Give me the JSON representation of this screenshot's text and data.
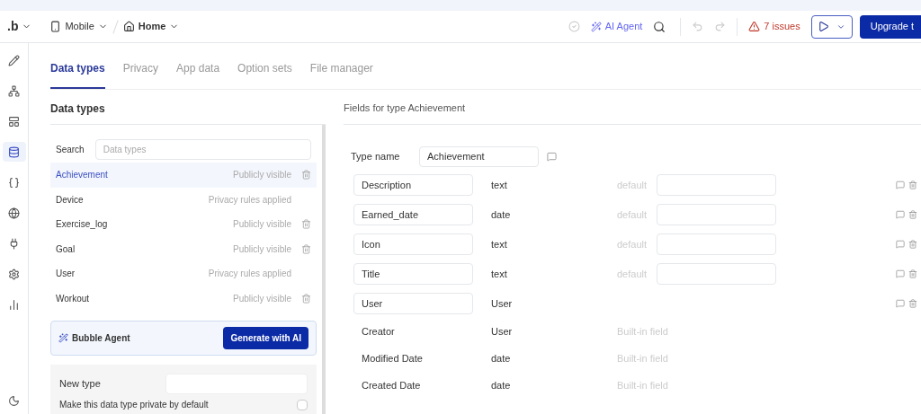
{
  "toolbar": {
    "logo": ".b",
    "device": "Mobile",
    "page": "Home",
    "agent": "AI Agent",
    "issues": "7 issues",
    "upgrade": "Upgrade t"
  },
  "tabs": [
    {
      "label": "Data types",
      "selected": true
    },
    {
      "label": "Privacy",
      "selected": false
    },
    {
      "label": "App data",
      "selected": false
    },
    {
      "label": "Option sets",
      "selected": false
    },
    {
      "label": "File manager",
      "selected": false
    }
  ],
  "sidebar_rail": [
    {
      "selected": false
    },
    {
      "selected": false
    },
    {
      "selected": false
    },
    {
      "selected": true
    },
    {
      "selected": false
    },
    {
      "selected": false
    },
    {
      "selected": false
    },
    {
      "selected": false
    },
    {
      "selected": false
    }
  ],
  "data_types_panel": {
    "title": "Data types",
    "search_label": "Search",
    "search_placeholder": "Data types",
    "items": [
      {
        "name": "Achievement",
        "visibility": "Publicly visible",
        "deletable": true,
        "selected": true
      },
      {
        "name": "Device",
        "visibility": "Privacy rules applied",
        "deletable": false,
        "selected": false
      },
      {
        "name": "Exercise_log",
        "visibility": "Publicly visible",
        "deletable": true,
        "selected": false
      },
      {
        "name": "Goal",
        "visibility": "Publicly visible",
        "deletable": true,
        "selected": false
      },
      {
        "name": "User",
        "visibility": "Privacy rules applied",
        "deletable": false,
        "selected": false
      },
      {
        "name": "Workout",
        "visibility": "Publicly visible",
        "deletable": true,
        "selected": false
      }
    ],
    "agent_label": "Bubble Agent",
    "generate_button": "Generate with AI",
    "new_type_label": "New type",
    "private_label": "Make this data type private by default",
    "private_checked": false
  },
  "fields_panel": {
    "title": "Fields for type Achievement",
    "type_name_label": "Type name",
    "type_name": "Achievement",
    "fields": [
      {
        "kind": "custom",
        "name": "Description",
        "type": "text",
        "default_label": "default"
      },
      {
        "kind": "custom",
        "name": "Earned_date",
        "type": "date",
        "default_label": "default"
      },
      {
        "kind": "custom",
        "name": "Icon",
        "type": "text",
        "default_label": "default"
      },
      {
        "kind": "custom",
        "name": "Title",
        "type": "text",
        "default_label": "default"
      },
      {
        "kind": "custom",
        "name": "User",
        "type": "User"
      },
      {
        "kind": "builtin",
        "name": "Creator",
        "type": "User",
        "note": "Built-in field"
      },
      {
        "kind": "builtin",
        "name": "Modified Date",
        "type": "date",
        "note": "Built-in field"
      },
      {
        "kind": "builtin",
        "name": "Created Date",
        "type": "date",
        "note": "Built-in field"
      }
    ]
  }
}
